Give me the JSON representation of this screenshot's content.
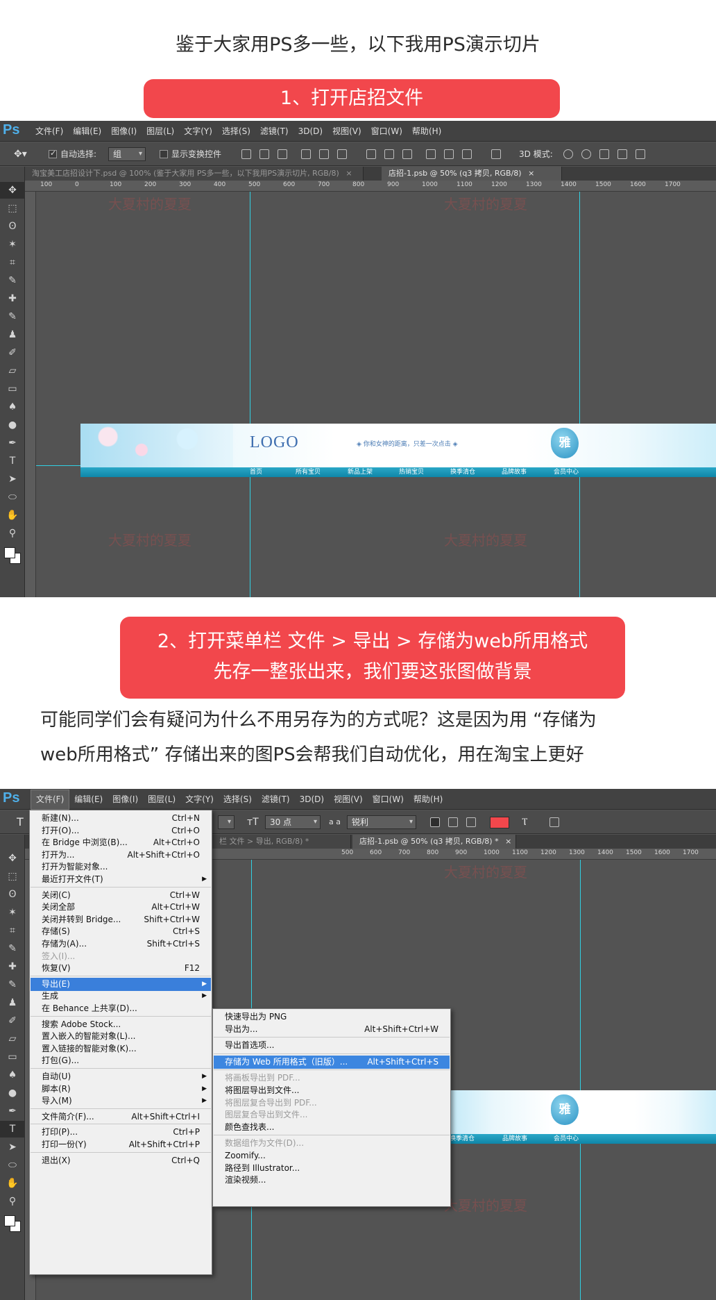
{
  "intro": {
    "heading": "鉴于大家用PS多一些，以下我用PS演示切片",
    "step1": "1、打开店招文件",
    "step2_line1": "2、打开菜单栏 文件 > 导出 > 存储为web所用格式",
    "step2_line2": "先存一整张出来，我们要这张图做背景",
    "para_line1": "可能同学们会有疑问为什么不用另存为的方式呢？这是因为用 “存储为",
    "para_line2": "web所用格式” 存储出来的图PS会帮我们自动优化，用在淘宝上更好"
  },
  "ps": {
    "logo": "Ps",
    "menus": [
      "文件(F)",
      "编辑(E)",
      "图像(I)",
      "图层(L)",
      "文字(Y)",
      "选择(S)",
      "滤镜(T)",
      "3D(D)",
      "视图(V)",
      "窗口(W)",
      "帮助(H)"
    ],
    "move_tool_icon": "move-icon",
    "auto_select_label": "自动选择:",
    "auto_select_value": "组",
    "show_transform_label": "显示变换控件",
    "mode_3d_label": "3D 模式:",
    "font_size_value": "30 点",
    "aa_label": "a a",
    "aa_value": "锐利",
    "text_color": "#f2474c",
    "tab1": "淘宝美工店招设计下.psd @ 100% (鉴于大家用 PS多一些，以下我用PS演示切片, RGB/8)",
    "tab2": "店招-1.psb @ 50% (q3 拷贝, RGB/8)",
    "tab1_short": "栏 文件 > 导出, RGB/8) *",
    "tab2_modified": "店招-1.psb @ 50% (q3 拷贝, RGB/8) *",
    "close_glyph": "×",
    "ruler_ticks": [
      "100",
      "0",
      "100",
      "200",
      "300",
      "400",
      "500",
      "600",
      "700",
      "800",
      "900",
      "1000",
      "1100",
      "1200",
      "1300",
      "1400",
      "1500",
      "1600",
      "1700"
    ],
    "ruler_ticks_2": [
      "500",
      "600",
      "700",
      "800",
      "900",
      "1000",
      "1100",
      "1200",
      "1300",
      "1400",
      "1500",
      "1600",
      "1700"
    ],
    "watermark": "大夏村的夏夏",
    "banner": {
      "logo": "LOGO",
      "slogan": "◈ 你和女神的距离，只差一次点击 ◈",
      "seal": "雅",
      "nav": [
        "首页",
        "所有宝贝",
        "新品上架",
        "热销宝贝",
        "换季清仓",
        "品牌故事",
        "会员中心"
      ]
    },
    "tools": [
      "move-icon",
      "marquee-icon",
      "lasso-icon",
      "magic-wand-icon",
      "crop-icon",
      "eyedropper-icon",
      "healing-icon",
      "brush-icon",
      "stamp-icon",
      "history-brush-icon",
      "eraser-icon",
      "gradient-icon",
      "blur-icon",
      "dodge-icon",
      "pen-icon",
      "type-icon",
      "path-select-icon",
      "shape-icon",
      "hand-icon",
      "zoom-icon"
    ],
    "tool_glyphs": [
      "✥",
      "⬚",
      "ʘ",
      "✶",
      "⌗",
      "✎",
      "✚",
      "✎",
      "♟",
      "✐",
      "▱",
      "▭",
      "♠",
      "●",
      "✒",
      "T",
      "➤",
      "⬭",
      "✋",
      "⚲"
    ]
  },
  "file_menu": {
    "items": [
      {
        "label": "新建(N)...",
        "shortcut": "Ctrl+N"
      },
      {
        "label": "打开(O)...",
        "shortcut": "Ctrl+O"
      },
      {
        "label": "在 Bridge 中浏览(B)...",
        "shortcut": "Alt+Ctrl+O"
      },
      {
        "label": "打开为...",
        "shortcut": "Alt+Shift+Ctrl+O"
      },
      {
        "label": "打开为智能对象...",
        "shortcut": ""
      },
      {
        "label": "最近打开文件(T)",
        "shortcut": "",
        "submenu": true
      },
      {
        "label": "关闭(C)",
        "shortcut": "Ctrl+W"
      },
      {
        "label": "关闭全部",
        "shortcut": "Alt+Ctrl+W"
      },
      {
        "label": "关闭并转到 Bridge...",
        "shortcut": "Shift+Ctrl+W"
      },
      {
        "label": "存储(S)",
        "shortcut": "Ctrl+S"
      },
      {
        "label": "存储为(A)...",
        "shortcut": "Shift+Ctrl+S"
      },
      {
        "label": "签入(I)...",
        "shortcut": "",
        "disabled": true
      },
      {
        "label": "恢复(V)",
        "shortcut": "F12"
      },
      {
        "label": "导出(E)",
        "shortcut": "",
        "submenu": true,
        "active": true
      },
      {
        "label": "生成",
        "shortcut": "",
        "submenu": true
      },
      {
        "label": "在 Behance 上共享(D)...",
        "shortcut": ""
      },
      {
        "label": "搜索 Adobe Stock...",
        "shortcut": ""
      },
      {
        "label": "置入嵌入的智能对象(L)...",
        "shortcut": ""
      },
      {
        "label": "置入链接的智能对象(K)...",
        "shortcut": ""
      },
      {
        "label": "打包(G)...",
        "shortcut": ""
      },
      {
        "label": "自动(U)",
        "shortcut": "",
        "submenu": true
      },
      {
        "label": "脚本(R)",
        "shortcut": "",
        "submenu": true
      },
      {
        "label": "导入(M)",
        "shortcut": "",
        "submenu": true
      },
      {
        "label": "文件简介(F)...",
        "shortcut": "Alt+Shift+Ctrl+I"
      },
      {
        "label": "打印(P)...",
        "shortcut": "Ctrl+P"
      },
      {
        "label": "打印一份(Y)",
        "shortcut": "Alt+Shift+Ctrl+P"
      },
      {
        "label": "退出(X)",
        "shortcut": "Ctrl+Q"
      }
    ]
  },
  "export_submenu": {
    "items": [
      {
        "label": "快速导出为 PNG",
        "shortcut": ""
      },
      {
        "label": "导出为...",
        "shortcut": "Alt+Shift+Ctrl+W"
      },
      {
        "label": "导出首选项...",
        "shortcut": ""
      },
      {
        "label": "存储为 Web 所用格式（旧版）...",
        "shortcut": "Alt+Shift+Ctrl+S",
        "active": true
      },
      {
        "label": "将画板导出到 PDF...",
        "shortcut": "",
        "disabled": true
      },
      {
        "label": "将图层导出到文件...",
        "shortcut": ""
      },
      {
        "label": "将图层复合导出到 PDF...",
        "shortcut": "",
        "disabled": true
      },
      {
        "label": "图层复合导出到文件...",
        "shortcut": "",
        "disabled": true
      },
      {
        "label": "颜色查找表...",
        "shortcut": ""
      },
      {
        "label": "数据组作为文件(D)...",
        "shortcut": "",
        "disabled": true
      },
      {
        "label": "Zoomify...",
        "shortcut": ""
      },
      {
        "label": "路径到 Illustrator...",
        "shortcut": ""
      },
      {
        "label": "渲染视频...",
        "shortcut": ""
      }
    ]
  },
  "colors": {
    "pill": "#f2474c",
    "guide": "#31d1e4",
    "ps_bg": "#535353",
    "menu_highlight": "#3a7fdb"
  }
}
